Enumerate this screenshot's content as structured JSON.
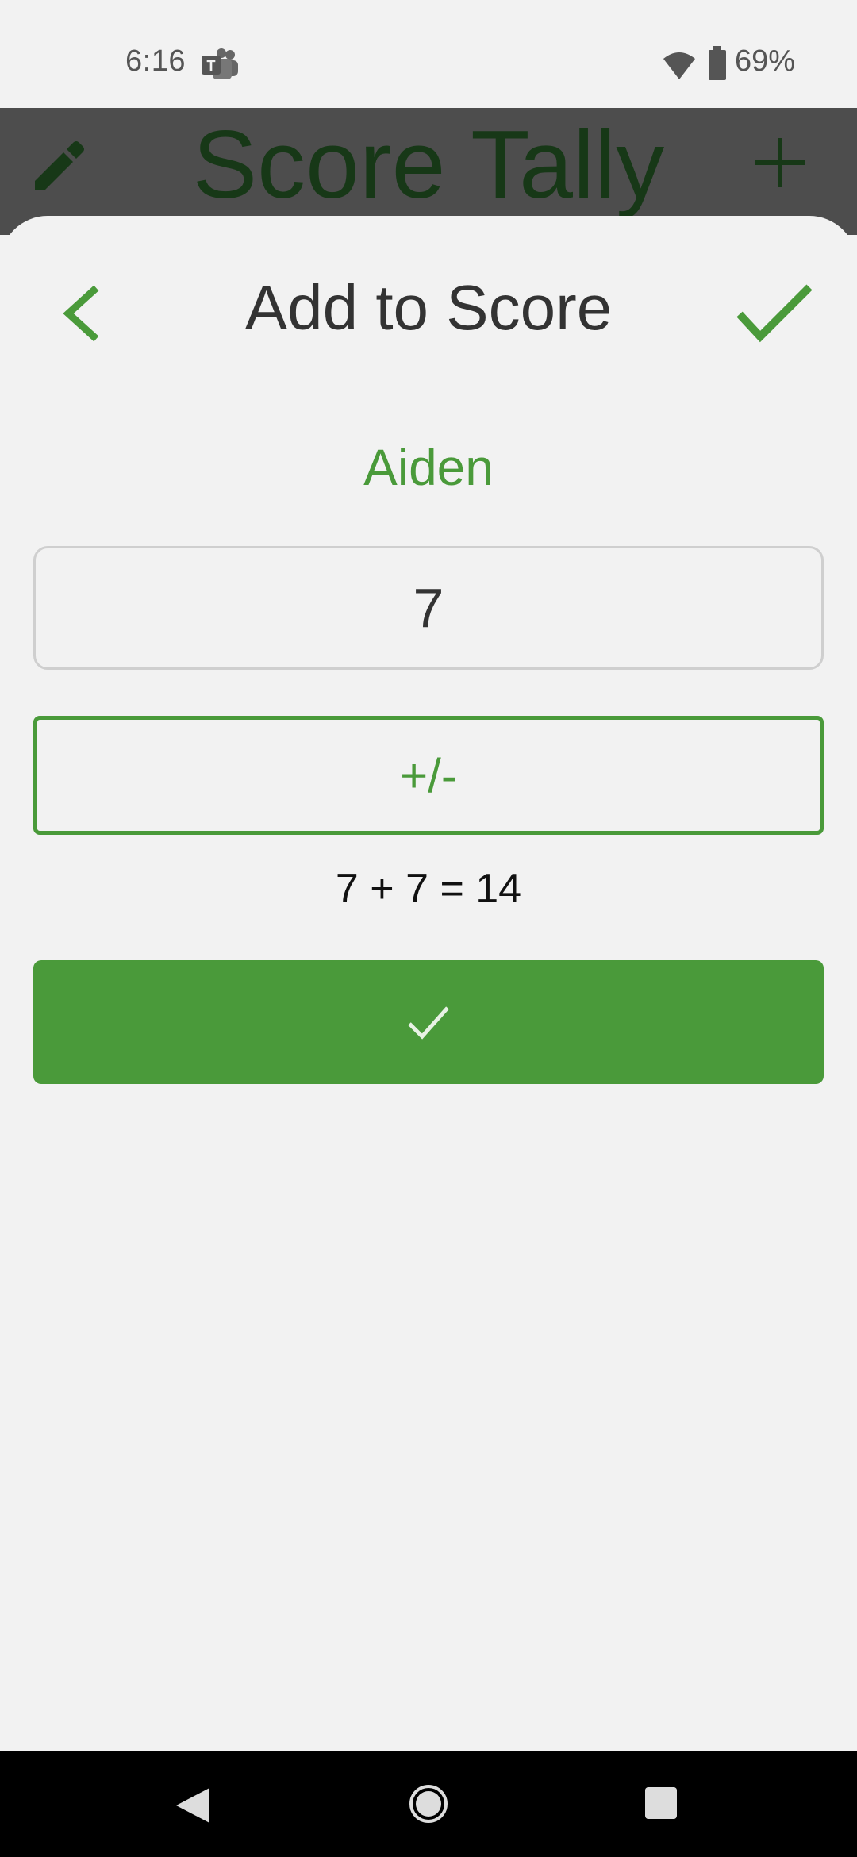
{
  "status_bar": {
    "time": "6:16",
    "battery": "69%",
    "icons": [
      "teams-icon",
      "wifi-icon",
      "battery-icon"
    ]
  },
  "app_bar": {
    "title": "Score Tally",
    "icons": [
      "edit-icon",
      "add-icon"
    ]
  },
  "dialog": {
    "title": "Add to Score",
    "player_name": "Aiden",
    "score_value": "7",
    "sign_toggle_label": "+/-",
    "equation": "7 + 7 = 14",
    "icons": [
      "back-icon",
      "confirm-icon",
      "check-icon"
    ]
  },
  "nav_bar": {
    "icons": [
      "nav-back-icon",
      "nav-home-icon",
      "nav-recents-icon"
    ]
  },
  "colors": {
    "accent_green": "#4a9a3a",
    "app_bar_bg": "#4d4d4d",
    "background": "#f2f2f2"
  }
}
